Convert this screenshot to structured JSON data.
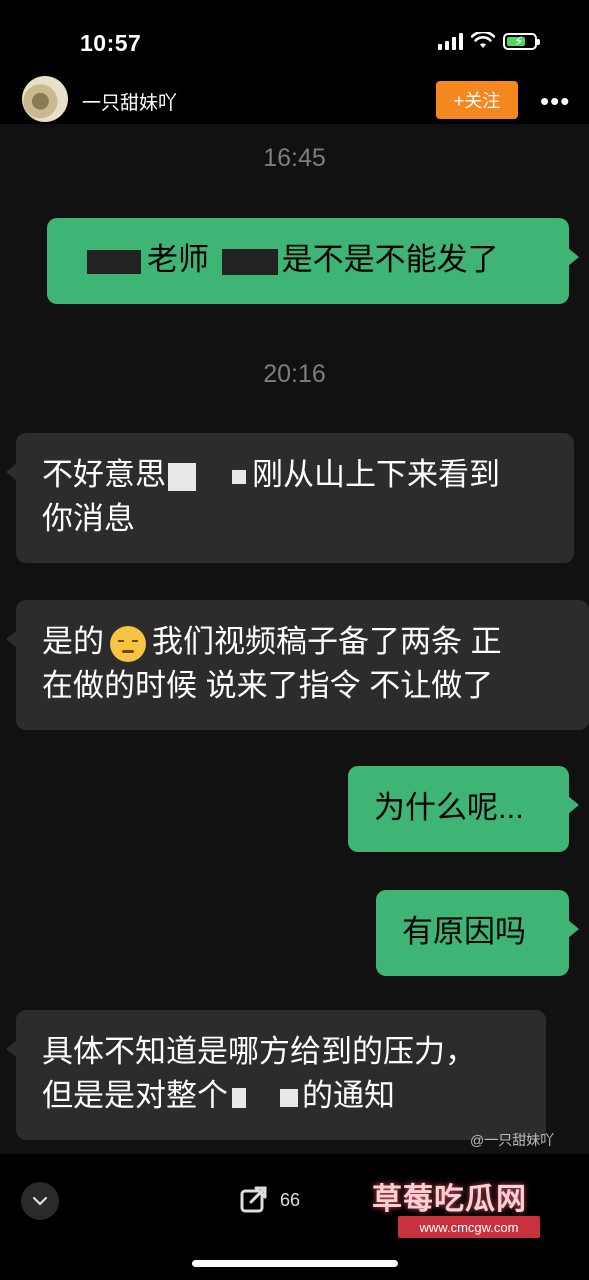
{
  "status_bar": {
    "time": "10:57"
  },
  "header": {
    "username": "一只甜妹吖",
    "follow_label": "+关注",
    "more_label": "•••"
  },
  "chat": {
    "timestamps": [
      "16:45",
      "20:16"
    ],
    "messages": [
      {
        "from": "me",
        "segments": [
          "老师",
          "是不是不能发了"
        ]
      },
      {
        "from": "them",
        "segments": [
          "不好意思",
          "刚从山上下来看到",
          "你消息"
        ]
      },
      {
        "from": "them",
        "segments": [
          "是的",
          "我们视频稿子备了两条 正",
          "在做的时候 说来了指令 不让做了"
        ]
      },
      {
        "from": "me",
        "segments": [
          "为什么呢..."
        ]
      },
      {
        "from": "me",
        "segments": [
          "有原因吗"
        ]
      },
      {
        "from": "them",
        "segments": [
          "具体不知道是哪方给到的压力，",
          "但是是对整个",
          "的通知"
        ]
      }
    ]
  },
  "weibo_handle": "@一只甜妹吖",
  "bottom_bar": {
    "collapse_icon": "chevron-down-icon",
    "share_count": "66"
  },
  "watermark": {
    "title": "草莓吃瓜网",
    "url": "www.cmcgw.com"
  },
  "colors": {
    "my_bubble": "#3eb575",
    "their_bubble": "#2c2c2c",
    "follow_button": "#f5871f"
  }
}
